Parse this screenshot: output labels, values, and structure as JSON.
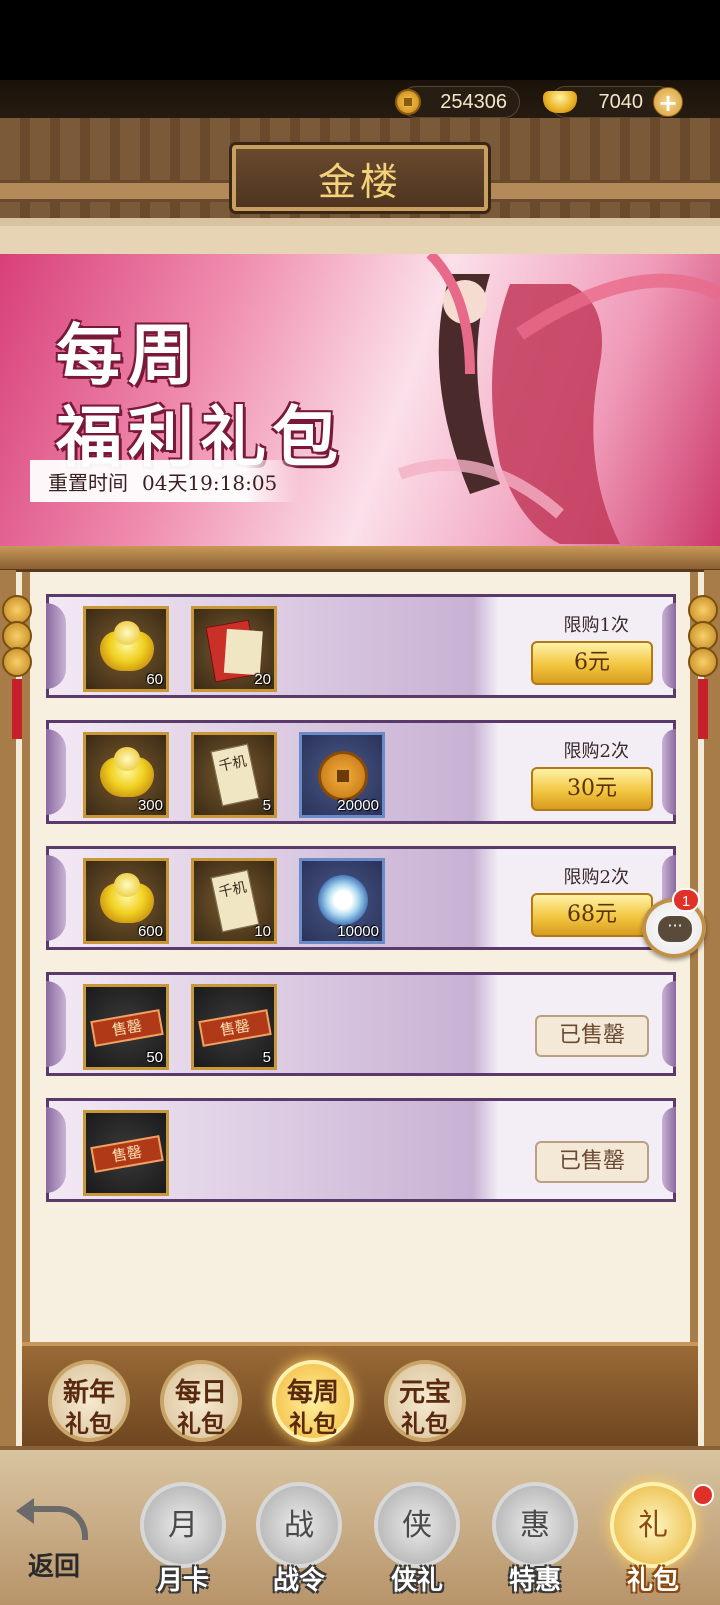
{
  "header": {
    "coins": "254306",
    "gold_ingots": "7040",
    "title": "金楼"
  },
  "banner": {
    "title_line1": "每周",
    "title_line2": "福利礼包",
    "reset_label": "重置时间",
    "reset_time": "04天19:18:05"
  },
  "packs": [
    {
      "items": [
        {
          "icon": "gold-ingot-icon",
          "qty": "60"
        },
        {
          "icon": "scroll-bundle-icon",
          "qty": "20"
        }
      ],
      "limit": "限购1次",
      "price": "6元"
    },
    {
      "items": [
        {
          "icon": "gold-ingot-icon",
          "qty": "300"
        },
        {
          "icon": "qianji-scroll-icon",
          "qty": "5",
          "text": "千机"
        },
        {
          "icon": "bronze-coin-icon",
          "qty": "20000"
        }
      ],
      "limit": "限购2次",
      "price": "30元"
    },
    {
      "items": [
        {
          "icon": "gold-ingot-icon",
          "qty": "600"
        },
        {
          "icon": "qianji-scroll-icon",
          "qty": "10",
          "text": "千机"
        },
        {
          "icon": "swirl-orb-icon",
          "qty": "10000"
        }
      ],
      "limit": "限购2次",
      "price": "68元"
    },
    {
      "items": [
        {
          "icon": "sold-out-item-icon",
          "qty": "50",
          "tag": "售罄"
        },
        {
          "icon": "sold-out-item-icon",
          "qty": "5",
          "tag": "售罄"
        }
      ],
      "status": "已售罄"
    },
    {
      "items": [
        {
          "icon": "sold-out-item-icon",
          "tag": "售罄"
        }
      ],
      "status": "已售罄"
    }
  ],
  "chat": {
    "badge": "1",
    "bubble": "···"
  },
  "subtabs": [
    {
      "l1": "新年",
      "l2": "礼包"
    },
    {
      "l1": "每日",
      "l2": "礼包"
    },
    {
      "l1": "每周",
      "l2": "礼包",
      "active": true
    },
    {
      "l1": "元宝",
      "l2": "礼包"
    }
  ],
  "bottom_nav": {
    "back": "返回",
    "tabs": [
      {
        "label": "月卡",
        "glyph": "月"
      },
      {
        "label": "战令",
        "glyph": "战"
      },
      {
        "label": "侠礼",
        "glyph": "侠"
      },
      {
        "label": "特惠",
        "glyph": "惠"
      },
      {
        "label": "礼包",
        "glyph": "礼",
        "active": true
      }
    ]
  },
  "colors": {
    "accent": "#f2c640",
    "banner_pink": "#f08fb0",
    "badge_red": "#e03028"
  }
}
